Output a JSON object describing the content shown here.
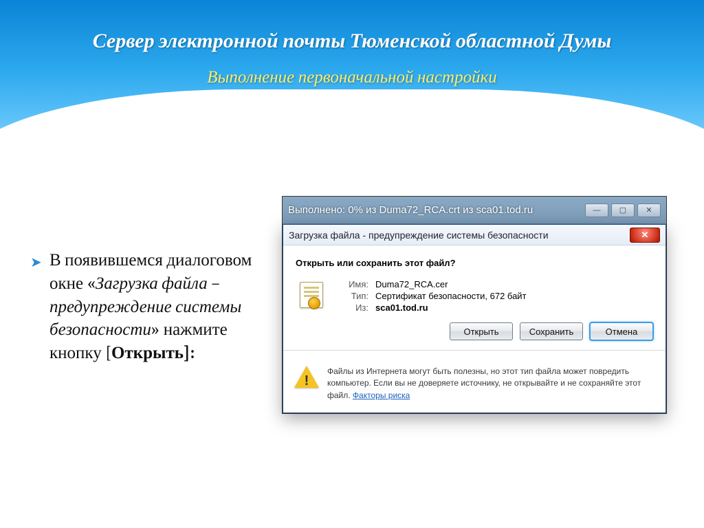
{
  "header": {
    "title": "Сервер электронной почты Тюменской областной Думы",
    "subtitle": "Выполнение первоначальной настройки"
  },
  "bullet": {
    "lead": "В появившемся диалоговом окне «",
    "dlgname": "Загрузка файла – предупреждение системы безопасности",
    "mid": "» нажмите кнопку [",
    "btn": "Открыть",
    "tail": "]:"
  },
  "glass": {
    "title": "Выполнено: 0% из Duma72_RCA.crt из sca01.tod.ru",
    "min": "—",
    "max": "▢",
    "close": "✕"
  },
  "modal": {
    "title": "Загрузка файла - предупреждение системы безопасности",
    "close": "✕",
    "question": "Открыть или сохранить этот файл?",
    "name_label": "Имя:",
    "name_value": "Duma72_RCA.cer",
    "type_label": "Тип:",
    "type_value": "Сертификат безопасности, 672 байт",
    "from_label": "Из:",
    "from_value": "sca01.tod.ru",
    "open": "Открыть",
    "save": "Сохранить",
    "cancel": "Отмена",
    "warn_text": "Файлы из Интернета могут быть полезны, но этот тип файла может повредить компьютер. Если вы не доверяете источнику, не открывайте и не сохраняйте этот файл. ",
    "warn_link": "Факторы риска"
  }
}
